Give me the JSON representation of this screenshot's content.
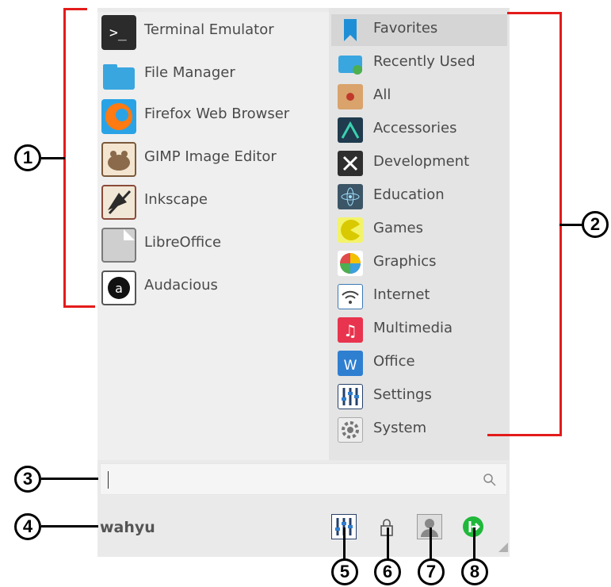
{
  "apps": [
    {
      "label": "Terminal Emulator",
      "icon": "terminal-icon"
    },
    {
      "label": "File Manager",
      "icon": "folder-icon"
    },
    {
      "label": "Firefox Web Browser",
      "icon": "firefox-icon"
    },
    {
      "label": "GIMP Image Editor",
      "icon": "gimp-icon"
    },
    {
      "label": "Inkscape",
      "icon": "inkscape-icon"
    },
    {
      "label": "LibreOffice",
      "icon": "libreoffice-icon"
    },
    {
      "label": "Audacious",
      "icon": "audacious-icon"
    }
  ],
  "categories": [
    {
      "label": "Favorites",
      "icon": "bookmark-icon",
      "selected": true
    },
    {
      "label": "Recently Used",
      "icon": "recent-folder-icon"
    },
    {
      "label": "All",
      "icon": "all-apps-icon"
    },
    {
      "label": "Accessories",
      "icon": "accessories-icon"
    },
    {
      "label": "Development",
      "icon": "development-icon"
    },
    {
      "label": "Education",
      "icon": "education-icon"
    },
    {
      "label": "Games",
      "icon": "games-icon"
    },
    {
      "label": "Graphics",
      "icon": "graphics-icon"
    },
    {
      "label": "Internet",
      "icon": "internet-icon"
    },
    {
      "label": "Multimedia",
      "icon": "multimedia-icon"
    },
    {
      "label": "Office",
      "icon": "office-icon"
    },
    {
      "label": "Settings",
      "icon": "settings-icon"
    },
    {
      "label": "System",
      "icon": "system-icon"
    }
  ],
  "search": {
    "value": "",
    "placeholder": "",
    "icon": "search-icon"
  },
  "user": {
    "name": "wahyu"
  },
  "actions": [
    {
      "name": "settings-manager",
      "icon": "settings-sliders-icon"
    },
    {
      "name": "lock-screen",
      "icon": "lock-icon"
    },
    {
      "name": "switch-user",
      "icon": "user-icon"
    },
    {
      "name": "logout",
      "icon": "logout-icon"
    }
  ],
  "annotations": [
    "1",
    "2",
    "3",
    "4",
    "5",
    "6",
    "7",
    "8"
  ],
  "colors": {
    "accent_line": "#e31b1b",
    "favorites_highlight": "#d5d5d5",
    "logout_green": "#1fb83a"
  }
}
